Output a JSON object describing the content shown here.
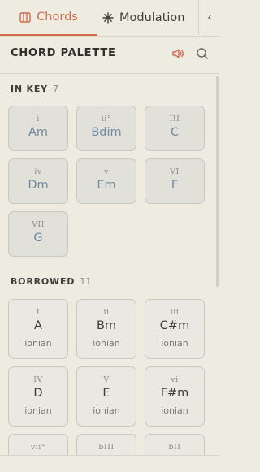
{
  "tabs": {
    "chords_label": "Chords",
    "modulation_label": "Modulation",
    "more_label": "‹"
  },
  "header": {
    "title": "CHORD PALETTE"
  },
  "in_key": {
    "title": "IN KEY",
    "count": "7",
    "chords": [
      {
        "numeral": "i",
        "name": "Am"
      },
      {
        "numeral": "ii°",
        "name": "Bdim"
      },
      {
        "numeral": "III",
        "name": "C"
      },
      {
        "numeral": "iv",
        "name": "Dm"
      },
      {
        "numeral": "v",
        "name": "Em"
      },
      {
        "numeral": "VI",
        "name": "F"
      },
      {
        "numeral": "VII",
        "name": "G"
      }
    ]
  },
  "borrowed": {
    "title": "BORROWED",
    "count": "11",
    "chords": [
      {
        "numeral": "I",
        "name": "A",
        "mode": "ionian"
      },
      {
        "numeral": "ii",
        "name": "Bm",
        "mode": "ionian"
      },
      {
        "numeral": "iii",
        "name": "C#m",
        "mode": "ionian"
      },
      {
        "numeral": "IV",
        "name": "D",
        "mode": "ionian"
      },
      {
        "numeral": "V",
        "name": "E",
        "mode": "ionian"
      },
      {
        "numeral": "vi",
        "name": "F#m",
        "mode": "ionian"
      },
      {
        "numeral": "vii°",
        "name": "",
        "mode": ""
      },
      {
        "numeral": "bIII",
        "name": "",
        "mode": ""
      },
      {
        "numeral": "bII",
        "name": "",
        "mode": ""
      }
    ]
  },
  "colors": {
    "accent": "#d06a4b",
    "in_key_chord": "#6e8aa0"
  }
}
